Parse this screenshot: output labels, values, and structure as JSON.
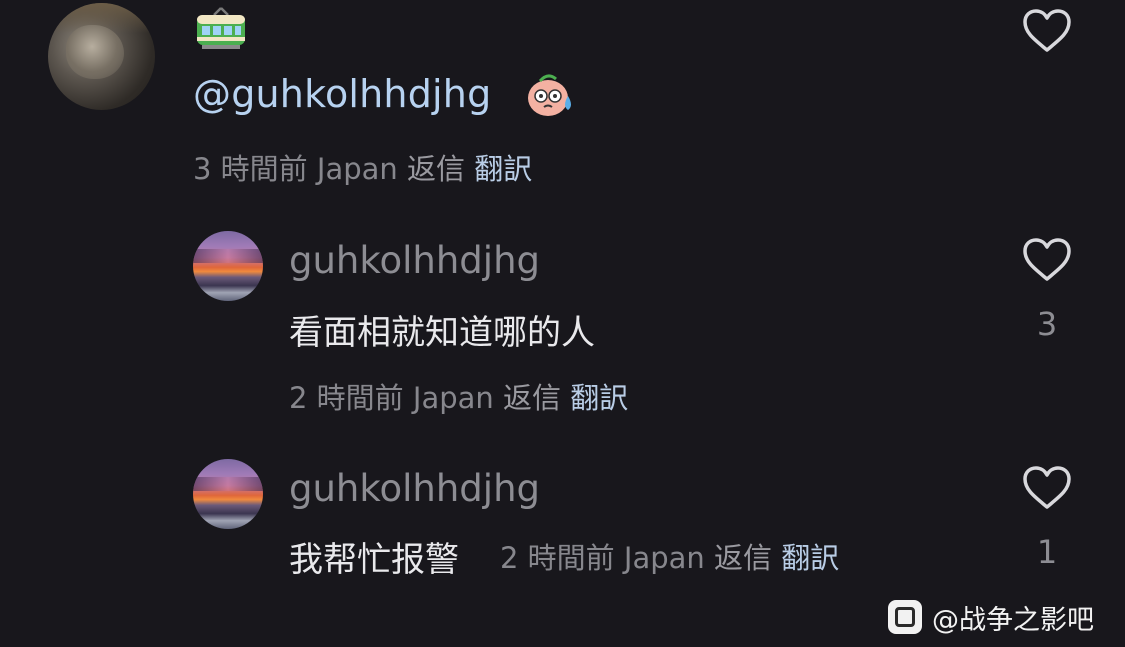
{
  "comment": {
    "avatar_icon": "user-avatar-photo",
    "emoji_top": "tram-emoji",
    "mention": "@guhkolhhdjhg",
    "mention_emoji": "sweating-face-emoji",
    "time": "3 時間前",
    "region": "Japan",
    "reply_label": "返信",
    "translate_label": "翻訳",
    "like_icon": "heart-icon"
  },
  "replies": [
    {
      "avatar_icon": "sunset-avatar",
      "username": "guhkolhhdjhg",
      "text": "看面相就知道哪的人",
      "time": "2 時間前",
      "region": "Japan",
      "reply_label": "返信",
      "translate_label": "翻訳",
      "like_icon": "heart-icon",
      "like_count": "3"
    },
    {
      "avatar_icon": "sunset-avatar",
      "username": "guhkolhhdjhg",
      "text": "我帮忙报警",
      "time": "2 時間前",
      "region": "Japan",
      "reply_label": "返信",
      "translate_label": "翻訳",
      "like_icon": "heart-icon",
      "like_count": "1"
    }
  ],
  "watermark": {
    "icon": "tieba-logo-icon",
    "text": "@战争之影吧"
  },
  "colors": {
    "background": "#18171c",
    "mention": "#b7d2f0",
    "translate": "#b9cde6",
    "muted": "#87878d"
  }
}
